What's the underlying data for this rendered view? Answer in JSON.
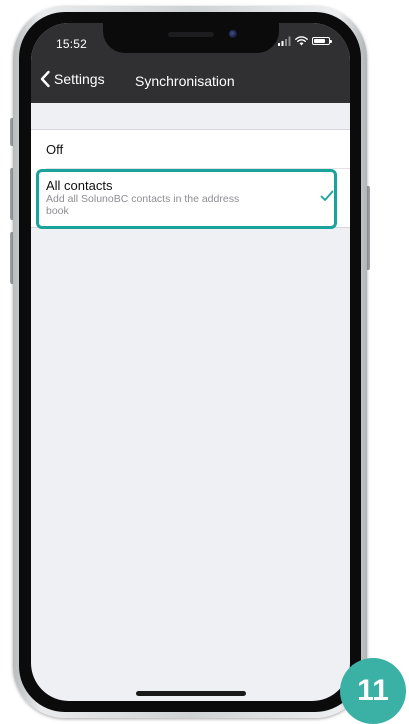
{
  "status_bar": {
    "time": "15:52"
  },
  "nav": {
    "back_label": "Settings",
    "title": "Synchronisation"
  },
  "options": [
    {
      "title": "Off"
    },
    {
      "title": "All contacts",
      "subtitle": "Add all SolunoBC contacts in the address book",
      "selected": true
    }
  ],
  "accent_colors": {
    "highlight": "#1aa39a",
    "checkmark": "#1aa39a",
    "step_badge": "#3bb1a6",
    "nav_background": "#303032"
  },
  "icons": {
    "back": "chevron-left-icon",
    "selected": "checkmark-icon",
    "signal": "signal-icon",
    "wifi": "wifi-icon",
    "battery": "battery-icon"
  },
  "step_badge": {
    "number": "11"
  }
}
